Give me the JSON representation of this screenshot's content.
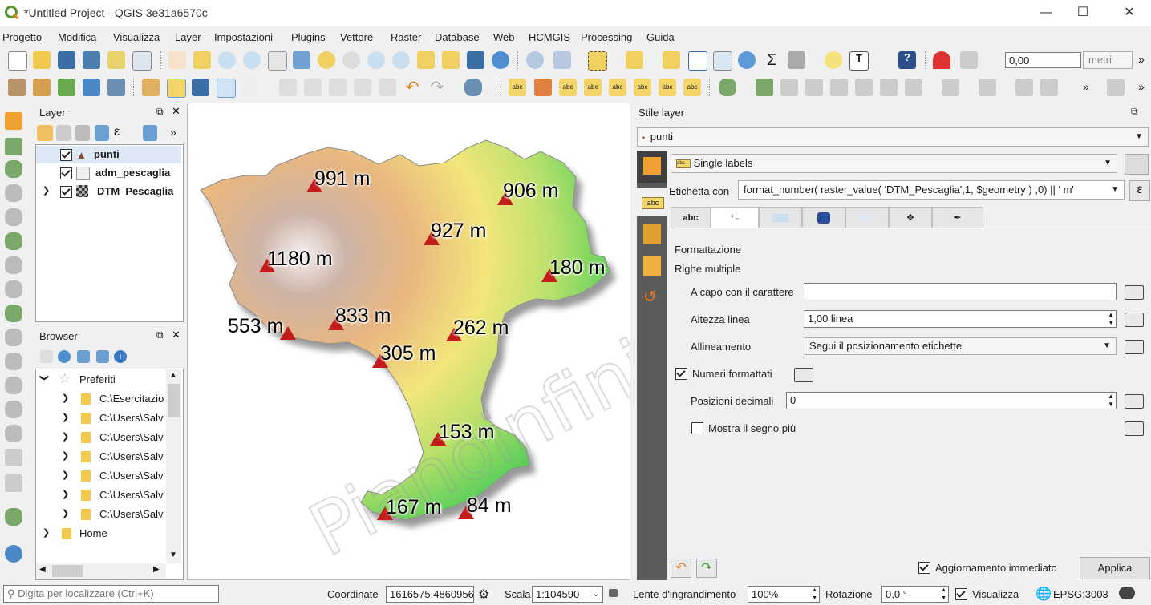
{
  "window": {
    "title": "*Untitled Project - QGIS 3e31a6570c"
  },
  "menu": [
    "Progetto",
    "Modifica",
    "Visualizza",
    "Layer",
    "Impostazioni",
    "Plugins",
    "Vettore",
    "Raster",
    "Database",
    "Web",
    "HCMGIS",
    "Processing",
    "Guida"
  ],
  "toolbar": {
    "measure_value": "0,00",
    "units": "metri"
  },
  "layers_panel": {
    "title": "Layer",
    "items": [
      {
        "name": "punti",
        "checked": true
      },
      {
        "name": "adm_pescaglia",
        "checked": true
      },
      {
        "name": "DTM_Pescaglia",
        "checked": true
      }
    ]
  },
  "browser_panel": {
    "title": "Browser",
    "favorites": "Preferiti",
    "items": [
      "C:\\Esercitazio",
      "C:\\Users\\Salv",
      "C:\\Users\\Salv",
      "C:\\Users\\Salv",
      "C:\\Users\\Salv",
      "C:\\Users\\Salv",
      "C:\\Users\\Salv"
    ],
    "home": "Home"
  },
  "map": {
    "labels": [
      "991 m",
      "906 m",
      "927 m",
      "1180 m",
      "180 m",
      "553 m",
      "833 m",
      "262 m",
      "305 m",
      "153 m",
      "167 m",
      "84 m"
    ],
    "watermark": "Pianoinfinito"
  },
  "style_panel": {
    "title": "Stile layer",
    "layer": "punti",
    "mode": "Single labels",
    "label_with_caption": "Etichetta con",
    "expression": "format_number(  raster_value( 'DTM_Pescaglia',1, $geometry  ) ,0) || ' m'",
    "tab_text": "abc",
    "section_format": "Formattazione",
    "section_multiline": "Righe multiple",
    "wrap_label": "A capo con il carattere",
    "wrap_value": "",
    "line_height_label": "Altezza linea",
    "line_height_value": "1,00 linea",
    "alignment_label": "Allineamento",
    "alignment_value": "Segui il posizionamento etichette",
    "formatted_numbers_label": "Numeri formattati",
    "decimals_label": "Posizioni decimali",
    "decimals_value": "0",
    "plus_sign_label": "Mostra il segno più",
    "live_update_label": "Aggiornamento immediato",
    "apply_label": "Applica"
  },
  "statusbar": {
    "search_placeholder": "Digita per localizzare (Ctrl+K)",
    "coord_label": "Coordinate",
    "coord_value": "1616575,4860956",
    "scale_label": "Scala",
    "scale_value": "1:104590",
    "magnifier_label": "Lente d'ingrandimento",
    "magnifier_value": "100%",
    "rotation_label": "Rotazione",
    "rotation_value": "0,0 °",
    "render_label": "Visualizza",
    "crs": "EPSG:3003"
  }
}
